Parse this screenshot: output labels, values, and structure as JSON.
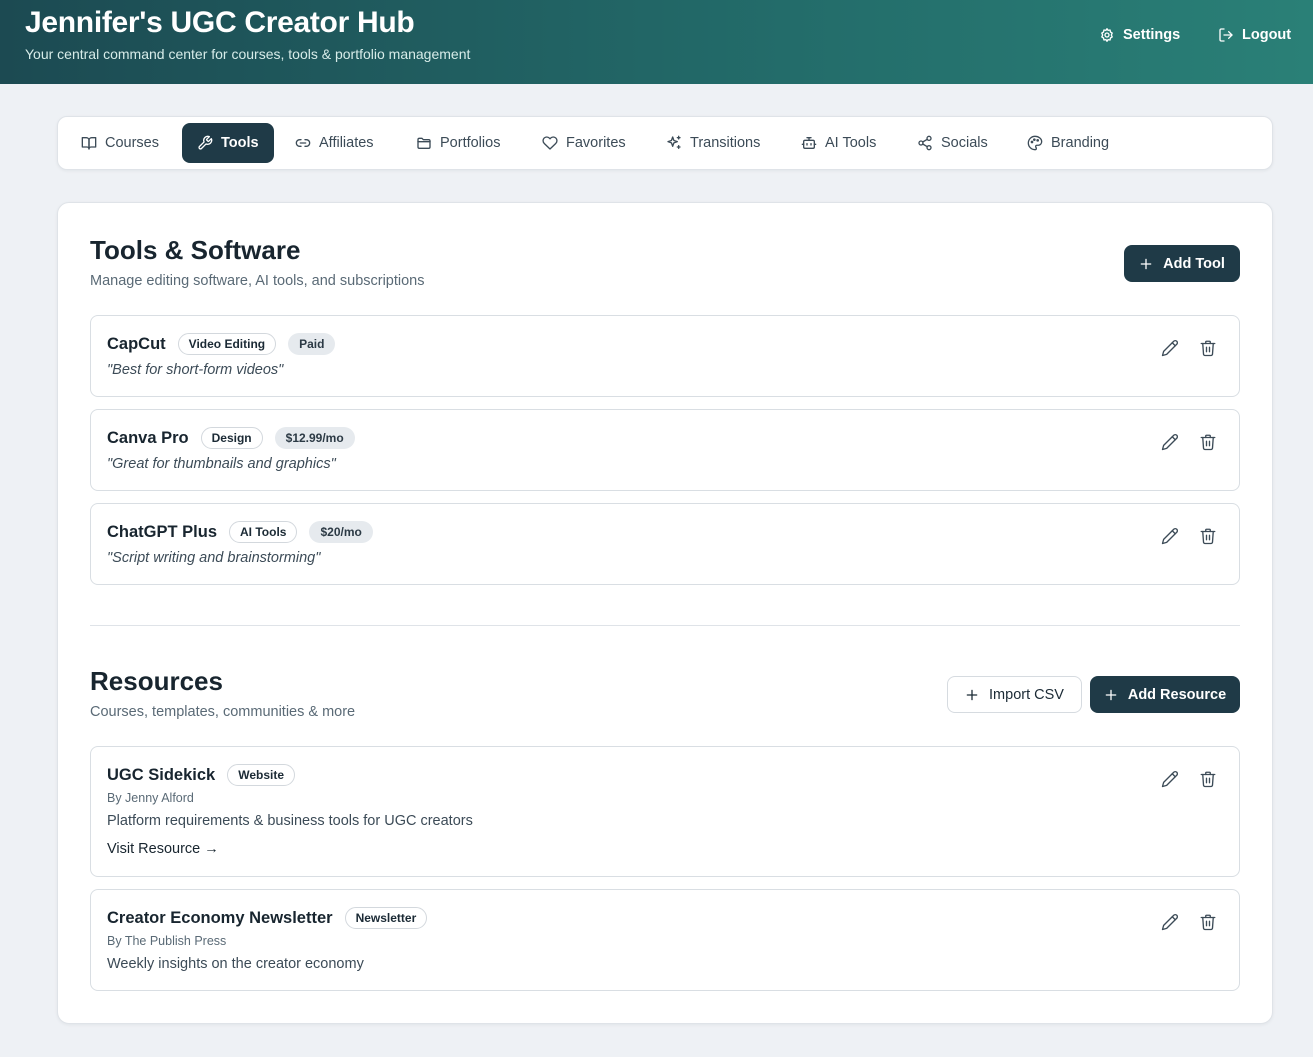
{
  "header": {
    "title": "Jennifer's UGC Creator Hub",
    "subtitle": "Your central command center for courses, tools & portfolio management",
    "settings_label": "Settings",
    "logout_label": "Logout"
  },
  "nav": {
    "tabs": [
      {
        "label": "Courses",
        "icon": "book-icon"
      },
      {
        "label": "Tools",
        "icon": "wrench-icon",
        "active": true
      },
      {
        "label": "Affiliates",
        "icon": "link-icon"
      },
      {
        "label": "Portfolios",
        "icon": "folder-icon"
      },
      {
        "label": "Favorites",
        "icon": "heart-icon"
      },
      {
        "label": "Transitions",
        "icon": "sparkles-icon"
      },
      {
        "label": "AI Tools",
        "icon": "bot-icon"
      },
      {
        "label": "Socials",
        "icon": "share-icon"
      },
      {
        "label": "Branding",
        "icon": "palette-icon"
      }
    ]
  },
  "tools": {
    "title": "Tools & Software",
    "subtitle": "Manage editing software, AI tools, and subscriptions",
    "add_label": "Add Tool",
    "items": [
      {
        "name": "CapCut",
        "category": "Video Editing",
        "price": "Paid",
        "note": "\"Best for short-form videos\""
      },
      {
        "name": "Canva Pro",
        "category": "Design",
        "price": "$12.99/mo",
        "note": "\"Great for thumbnails and graphics\""
      },
      {
        "name": "ChatGPT Plus",
        "category": "AI Tools",
        "price": "$20/mo",
        "note": "\"Script writing and brainstorming\""
      }
    ]
  },
  "resources": {
    "title": "Resources",
    "subtitle": "Courses, templates, communities & more",
    "import_label": "Import CSV",
    "add_label": "Add Resource",
    "items": [
      {
        "name": "UGC Sidekick",
        "type": "Website",
        "author": "By Jenny Alford",
        "description": "Platform requirements & business tools for UGC creators",
        "link_label": "Visit Resource →"
      },
      {
        "name": "Creator Economy Newsletter",
        "type": "Newsletter",
        "author": "By The Publish Press",
        "description": "Weekly insights on the creator economy"
      }
    ]
  },
  "colors": {
    "header_gradient_start": "#1c4a52",
    "header_gradient_end": "#2a8077",
    "accent_dark": "#1f3a47",
    "background": "#eef1f5"
  }
}
